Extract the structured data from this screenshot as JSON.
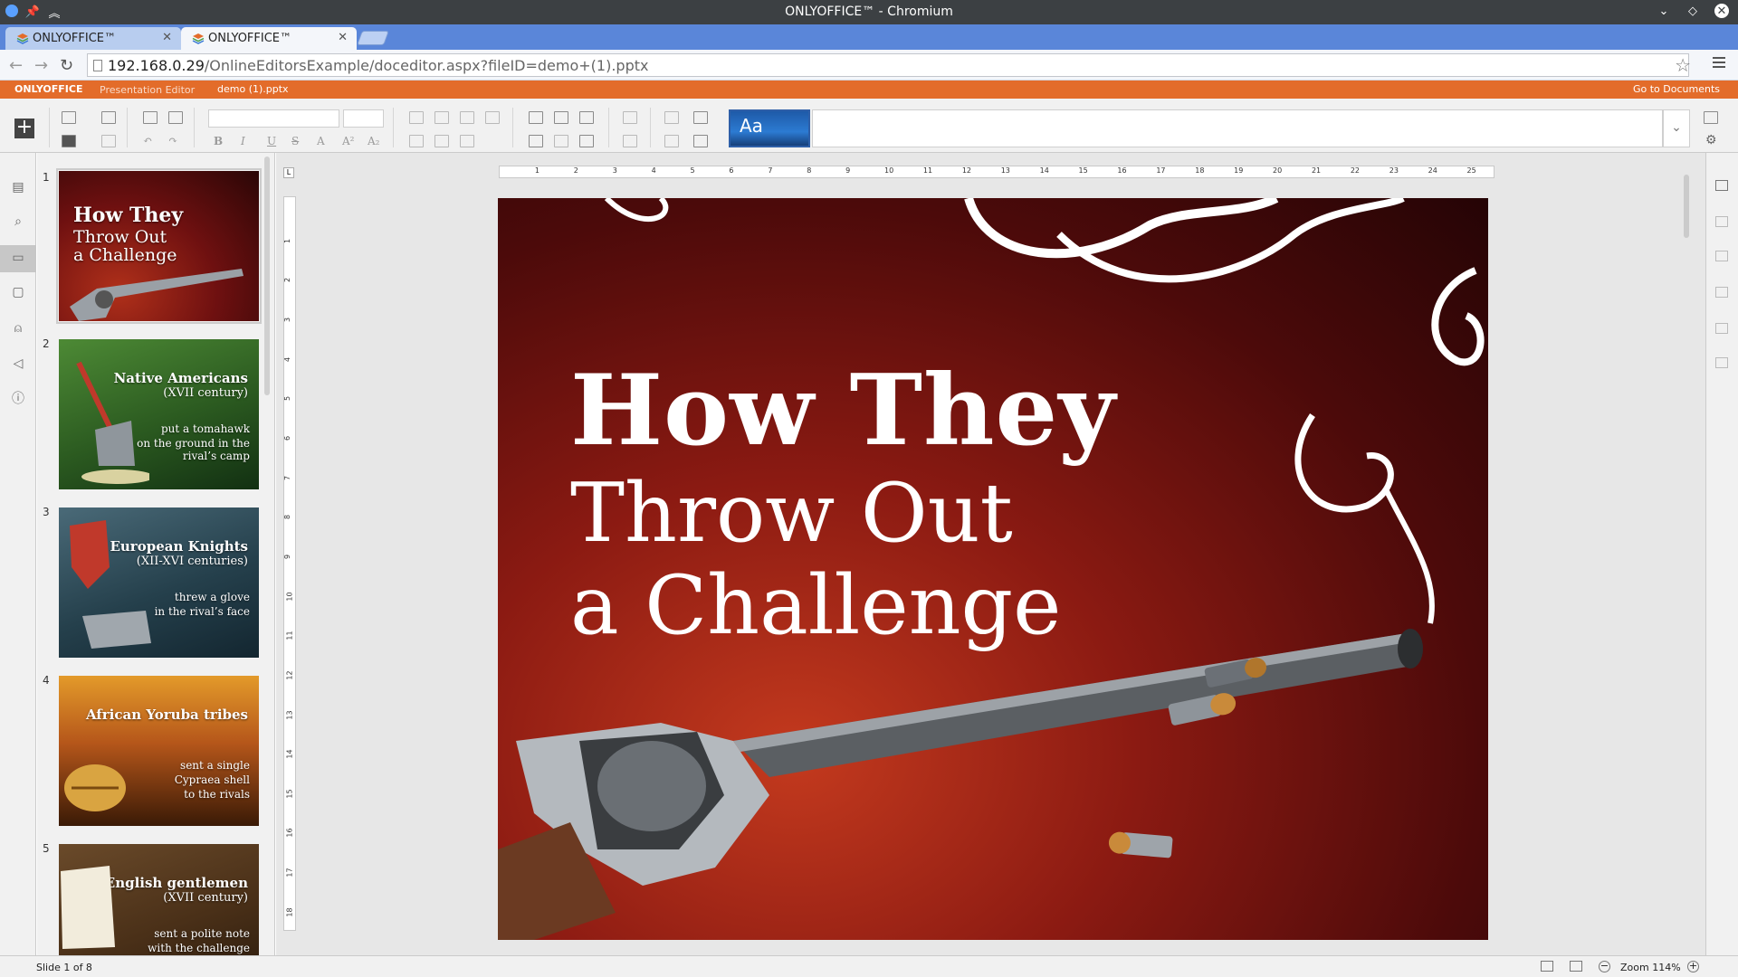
{
  "window": {
    "title": "ONLYOFFICE™ - Chromium"
  },
  "browser": {
    "tabs": [
      {
        "title": "ONLYOFFICE™",
        "active": false
      },
      {
        "title": "ONLYOFFICE™",
        "active": true
      }
    ],
    "url_host": "192.168.0.29",
    "url_path": "/OnlineEditorsExample/doceditor.aspx?fileID=demo+(1).pptx"
  },
  "editor_header": {
    "logo": "ONLYOFFICE",
    "app_name": "Presentation Editor",
    "doc_name": "demo (1).pptx",
    "goto_label": "Go to Documents",
    "bg_color": "#e36c2a"
  },
  "toolbar": {
    "theme_label": "Aa",
    "add_label": "+",
    "text_tools": {
      "bold": "B",
      "italic": "I",
      "underline": "U",
      "strike": "S",
      "font_color": "A",
      "superscript": "A²",
      "subscript": "A₂"
    }
  },
  "left_rail": {
    "icons": [
      "file-icon",
      "search-icon",
      "slides-icon",
      "comments-icon",
      "user-icon",
      "speaker-icon",
      "info-icon"
    ],
    "active": "slides-icon"
  },
  "slides": [
    {
      "num": "1",
      "lines": [
        "How They",
        "Throw Out",
        "a Challenge"
      ],
      "colors": [
        "#6e1010",
        "#2a0606"
      ]
    },
    {
      "num": "2",
      "title": "Native Americans",
      "subtitle": "(XVII century)",
      "body": [
        "put a tomahawk",
        "on the ground in the",
        "rival’s camp"
      ],
      "colors": [
        "#3c7a2c",
        "#123012"
      ]
    },
    {
      "num": "3",
      "title": "European Knights",
      "subtitle": "(XII-XVI centuries)",
      "body": [
        "threw a glove",
        "in the rival’s face"
      ],
      "colors": [
        "#3a5a6a",
        "#132630"
      ]
    },
    {
      "num": "4",
      "title": "African Yoruba tribes",
      "subtitle": "",
      "body": [
        "sent a single",
        "Cypraea shell",
        "to the rivals"
      ],
      "colors": [
        "#d07a1c",
        "#3a1a06"
      ]
    },
    {
      "num": "5",
      "title": "English gentlemen",
      "subtitle": "(XVII century)",
      "body": [
        "sent a polite note",
        "with the challenge"
      ],
      "colors": [
        "#7a5a36",
        "#2a1a0c"
      ]
    }
  ],
  "main_slide": {
    "line1": "How They",
    "line2": "Throw Out",
    "line3": "a Challenge"
  },
  "ruler": {
    "h_numbers": [
      "1",
      "2",
      "3",
      "4",
      "5",
      "6",
      "7",
      "8",
      "9",
      "10",
      "11",
      "12",
      "13",
      "14",
      "15",
      "16",
      "17",
      "18",
      "19",
      "20",
      "21",
      "22",
      "23",
      "24",
      "25"
    ],
    "v_numbers": [
      "1",
      "2",
      "3",
      "4",
      "5",
      "6",
      "7",
      "8",
      "9",
      "10",
      "11",
      "12",
      "13",
      "14",
      "15",
      "16",
      "17",
      "18"
    ],
    "corner": "L"
  },
  "status": {
    "slide_info": "Slide 1 of 8",
    "zoom_label": "Zoom 114%"
  }
}
